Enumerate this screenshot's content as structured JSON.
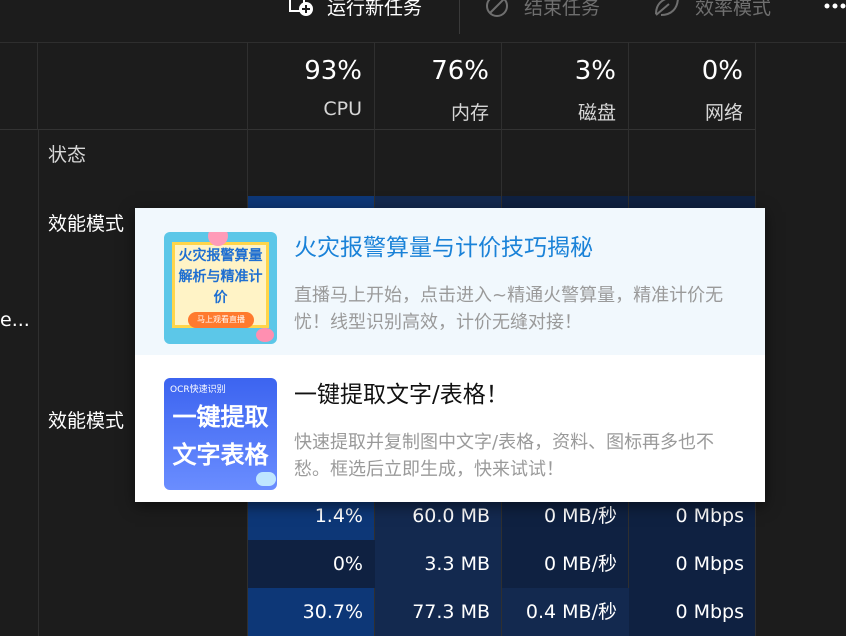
{
  "toolbar": {
    "run_new_task": "运行新任务",
    "end_task": "结束任务",
    "efficiency_mode": "效率模式",
    "more": "..."
  },
  "header": {
    "status_label": "状态",
    "columns": [
      {
        "percent": "93%",
        "label": "CPU"
      },
      {
        "percent": "76%",
        "label": "内存"
      },
      {
        "percent": "3%",
        "label": "磁盘"
      },
      {
        "percent": "0%",
        "label": "网络"
      }
    ]
  },
  "rows": {
    "status_1": "效能模式",
    "status_2": "效能模式",
    "truncated_name": "e...",
    "data": [
      {
        "cpu": "1.4%",
        "memory": "60.0 MB",
        "disk": "0 MB/秒",
        "network": "0 Mbps"
      },
      {
        "cpu": "0%",
        "memory": "3.3 MB",
        "disk": "0 MB/秒",
        "network": "0 Mbps"
      },
      {
        "cpu": "30.7%",
        "memory": "77.3 MB",
        "disk": "0.4 MB/秒",
        "network": "0 Mbps"
      }
    ]
  },
  "popup": {
    "ad1": {
      "title": "火灾报警算量与计价技巧揭秘",
      "desc": "直播马上开始，点击进入~精通火警算量，精准计价无忧！线型识别高效，计价无缝对接！",
      "thumb_text": "火灾报警算量解析与精准计价",
      "thumb_sub": "马上观看直播"
    },
    "ad2": {
      "title": "一键提取文字/表格！",
      "desc": "快速提取并复制图中文字/表格，资料、图标再多也不愁。框选后立即生成，快来试试！",
      "thumb_badge": "OCR快速识别",
      "thumb_line1": "一键提取",
      "thumb_line2": "文字表格"
    }
  },
  "colors": {
    "background": "#1c1c1c",
    "heat_dark": "#0f2141",
    "heat_mid": "#13294f",
    "heat_hot": "#0d3777",
    "ad_title_blue": "#1a82d8"
  }
}
